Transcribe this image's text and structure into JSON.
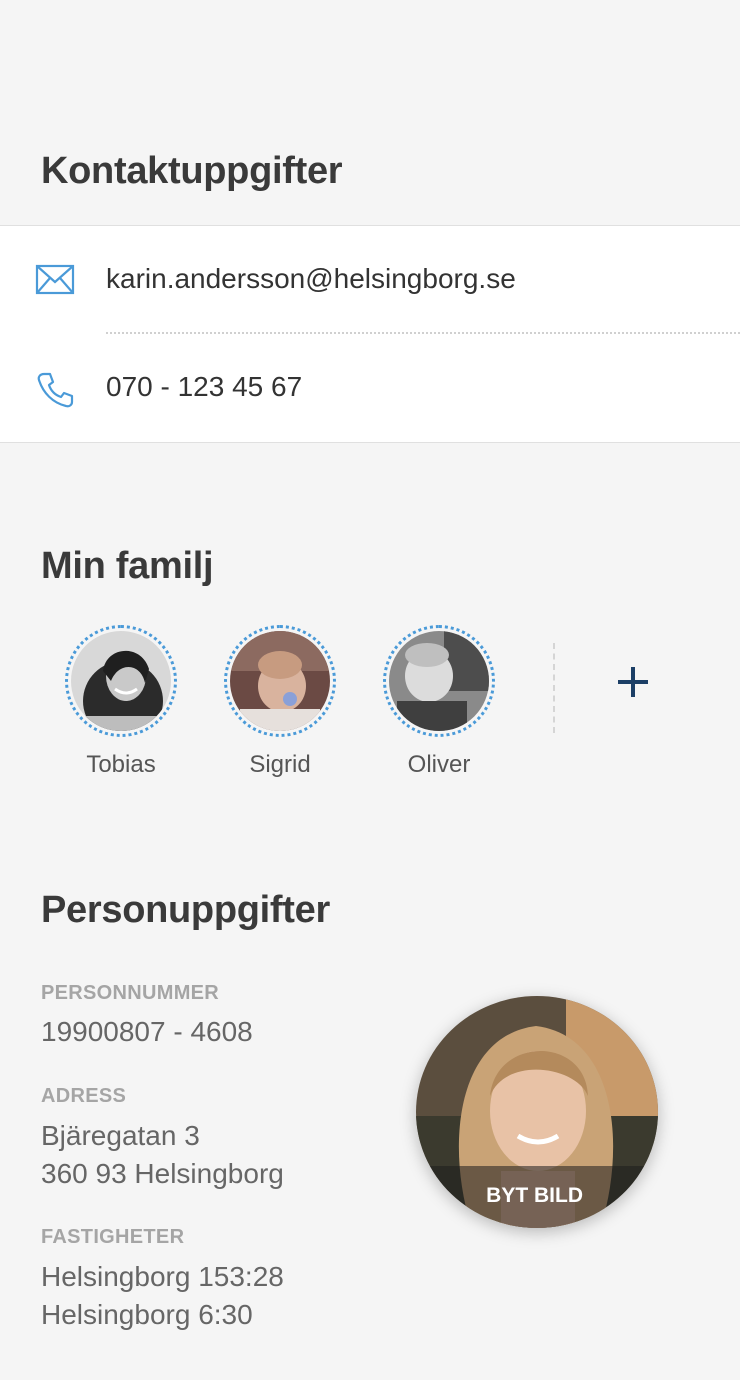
{
  "contact": {
    "title": "Kontaktuppgifter",
    "email": "karin.andersson@helsingborg.se",
    "phone": "070 - 123 45 67",
    "icon_color": "#4a9ad8"
  },
  "family": {
    "title": "Min familj",
    "members": [
      {
        "name": "Tobias"
      },
      {
        "name": "Sigrid"
      },
      {
        "name": "Oliver"
      }
    ],
    "add_icon": "plus-icon",
    "ring_color": "#4a9ad8"
  },
  "personal": {
    "title": "Personuppgifter",
    "personnummer_label": "PERSONNUMMER",
    "personnummer": "19900807 - 4608",
    "address_label": "ADRESS",
    "address_line1": "Bjäregatan 3",
    "address_line2": "360 93 Helsingborg",
    "properties_label": "FASTIGHETER",
    "property1": "Helsingborg 153:28",
    "property2": "Helsingborg 6:30",
    "change_photo_label": "BYT BILD"
  }
}
